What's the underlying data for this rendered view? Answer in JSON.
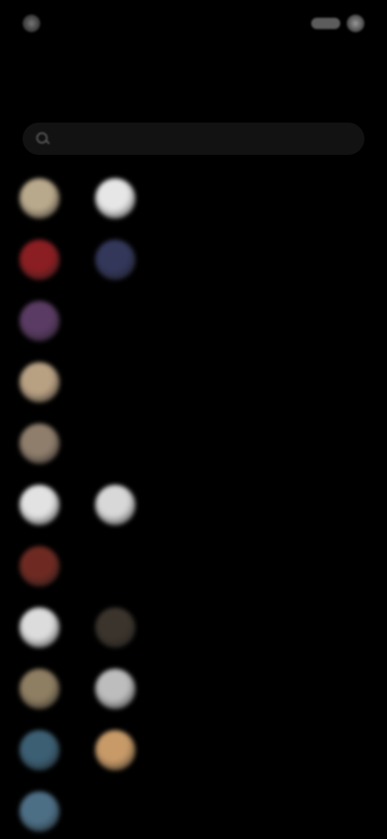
{
  "status_bar": {
    "time": "",
    "indicators": ""
  },
  "header": {
    "title": ""
  },
  "search": {
    "placeholder": "",
    "value": ""
  },
  "contacts": [
    [
      {
        "name": "",
        "avatar_color": "#b9a98c"
      },
      {
        "name": "",
        "avatar_color": "#e6e6e6"
      }
    ],
    [
      {
        "name": "",
        "avatar_color": "#8a1e22"
      },
      {
        "name": "",
        "avatar_color": "#33375a"
      }
    ],
    [
      {
        "name": "",
        "avatar_color": "#5a3b63"
      }
    ],
    [
      {
        "name": "",
        "avatar_color": "#b8a083"
      }
    ],
    [
      {
        "name": "",
        "avatar_color": "#8f7e6c"
      }
    ],
    [
      {
        "name": "",
        "avatar_color": "#e2e2e2"
      },
      {
        "name": "",
        "avatar_color": "#d8d8d8"
      }
    ],
    [
      {
        "name": "",
        "avatar_color": "#6e2a22"
      }
    ],
    [
      {
        "name": "",
        "avatar_color": "#dcdcdc"
      },
      {
        "name": "",
        "avatar_color": "#3b342c"
      }
    ],
    [
      {
        "name": "",
        "avatar_color": "#8e7e62"
      },
      {
        "name": "",
        "avatar_color": "#bdbdbd"
      }
    ],
    [
      {
        "name": "",
        "avatar_color": "#3c5f73"
      },
      {
        "name": "",
        "avatar_color": "#c79a68"
      }
    ],
    [
      {
        "name": "",
        "avatar_color": "#4d6f86"
      }
    ]
  ]
}
